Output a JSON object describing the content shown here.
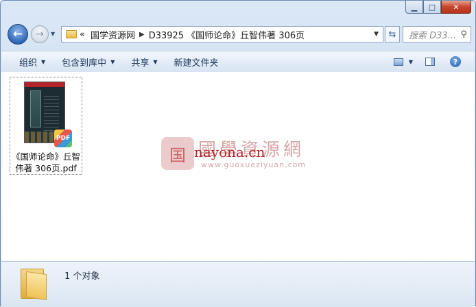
{
  "window": {
    "controls": {
      "minimize": "▁",
      "maximize": "□",
      "close": "✕"
    }
  },
  "nav": {
    "back_icon": "back-arrow-icon",
    "forward_icon": "forward-arrow-icon",
    "breadcrumb_overflow": "«",
    "breadcrumb": [
      "国学资源网",
      "D33925 《国师论命》丘智伟著 306页"
    ],
    "search_placeholder": "搜索 D33..."
  },
  "toolbar": {
    "organize": "组织",
    "include_library": "包含到库中",
    "share": "共享",
    "new_folder": "新建文件夹"
  },
  "file": {
    "name_line1": "《国师论命》丘智",
    "name_line2": "伟著 306页.pdf",
    "badge": "PDF"
  },
  "watermark": {
    "logo_char": "国",
    "title": "國學資源網",
    "overlay": "nayona.cn",
    "url": "www.guoxueziyuan.com"
  },
  "status": {
    "count": "1 个对象"
  },
  "colors": {
    "frame": "#c9dbef",
    "accent": "#2f67b8",
    "close": "#c7452c"
  }
}
